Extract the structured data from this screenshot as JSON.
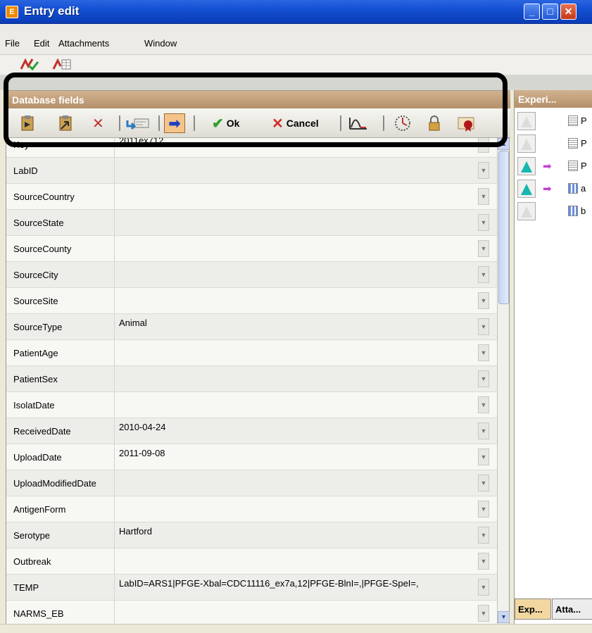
{
  "window": {
    "title": "Entry edit",
    "icon_letter": "E"
  },
  "menu": {
    "file": "File",
    "edit": "Edit",
    "attachments": "Attachments",
    "window": "Window"
  },
  "database_panel": {
    "title": "Database fields",
    "toolbar": {
      "ok_label": "Ok",
      "cancel_label": "Cancel"
    },
    "fields": [
      {
        "label": "Key",
        "value": "2011ex712"
      },
      {
        "label": "LabID",
        "value": ""
      },
      {
        "label": "SourceCountry",
        "value": ""
      },
      {
        "label": "SourceState",
        "value": ""
      },
      {
        "label": "SourceCounty",
        "value": ""
      },
      {
        "label": "SourceCity",
        "value": ""
      },
      {
        "label": "SourceSite",
        "value": ""
      },
      {
        "label": "SourceType",
        "value": "Animal"
      },
      {
        "label": "PatientAge",
        "value": ""
      },
      {
        "label": "PatientSex",
        "value": ""
      },
      {
        "label": "IsolatDate",
        "value": ""
      },
      {
        "label": "ReceivedDate",
        "value": "2010-04-24"
      },
      {
        "label": "UploadDate",
        "value": "2011-09-08"
      },
      {
        "label": "UploadModifiedDate",
        "value": ""
      },
      {
        "label": "AntigenForm",
        "value": ""
      },
      {
        "label": "Serotype",
        "value": "Hartford"
      },
      {
        "label": "Outbreak",
        "value": ""
      },
      {
        "label": "TEMP",
        "value": "LabID=ARS1|PFGE-Xbal=CDC11116_ex7a,12|PFGE-BlnI=,|PFGE-SpeI=,"
      },
      {
        "label": "NARMS_EB",
        "value": ""
      }
    ]
  },
  "experiments_panel": {
    "title": "Experi...",
    "items": [
      {
        "name": "P",
        "filled": false,
        "arrow": false,
        "doc": "list"
      },
      {
        "name": "P",
        "filled": false,
        "arrow": false,
        "doc": "list"
      },
      {
        "name": "P",
        "filled": true,
        "arrow": true,
        "doc": "list"
      },
      {
        "name": "a",
        "filled": true,
        "arrow": true,
        "doc": "grid"
      },
      {
        "name": "b",
        "filled": false,
        "arrow": false,
        "doc": "grid"
      }
    ],
    "tabs": [
      "Exp...",
      "Atta..."
    ]
  },
  "colors": {
    "title_bar": "#1450d2",
    "panel_header": "#b3906a",
    "highlight_border": "#000000",
    "flask_fill": "#17b7b0"
  }
}
